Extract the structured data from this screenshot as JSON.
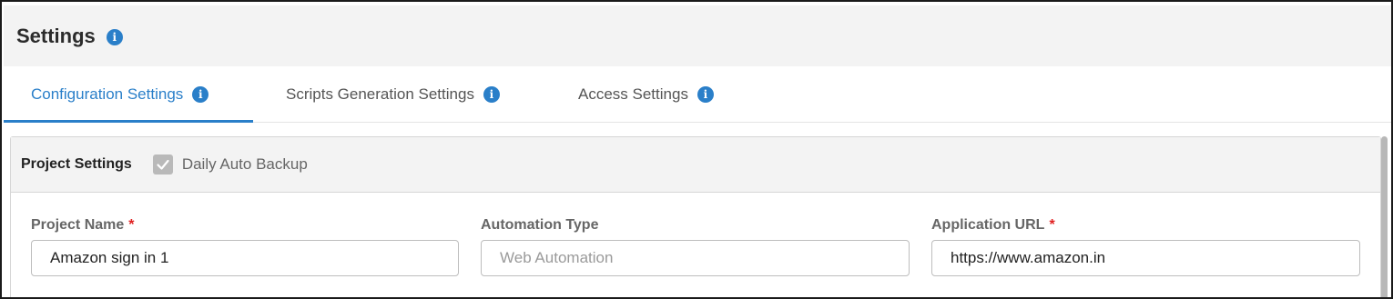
{
  "header": {
    "title": "Settings",
    "info_icon": "info-icon"
  },
  "tabs": [
    {
      "label": "Configuration Settings",
      "active": true
    },
    {
      "label": "Scripts Generation Settings",
      "active": false
    },
    {
      "label": "Access Settings",
      "active": false
    }
  ],
  "panel": {
    "title": "Project Settings",
    "daily_backup": {
      "label": "Daily Auto Backup",
      "checked": true,
      "disabled": true
    }
  },
  "fields": [
    {
      "label": "Project Name",
      "required": "*",
      "value": "Amazon sign in 1",
      "placeholder": ""
    },
    {
      "label": "Automation Type",
      "required": "",
      "value": "",
      "placeholder": "Web Automation"
    },
    {
      "label": "Application URL",
      "required": "*",
      "value": "https://www.amazon.in",
      "placeholder": ""
    }
  ],
  "colors": {
    "accent": "#2a7fc9",
    "required": "#e02020",
    "header_bg": "#f3f3f3"
  }
}
